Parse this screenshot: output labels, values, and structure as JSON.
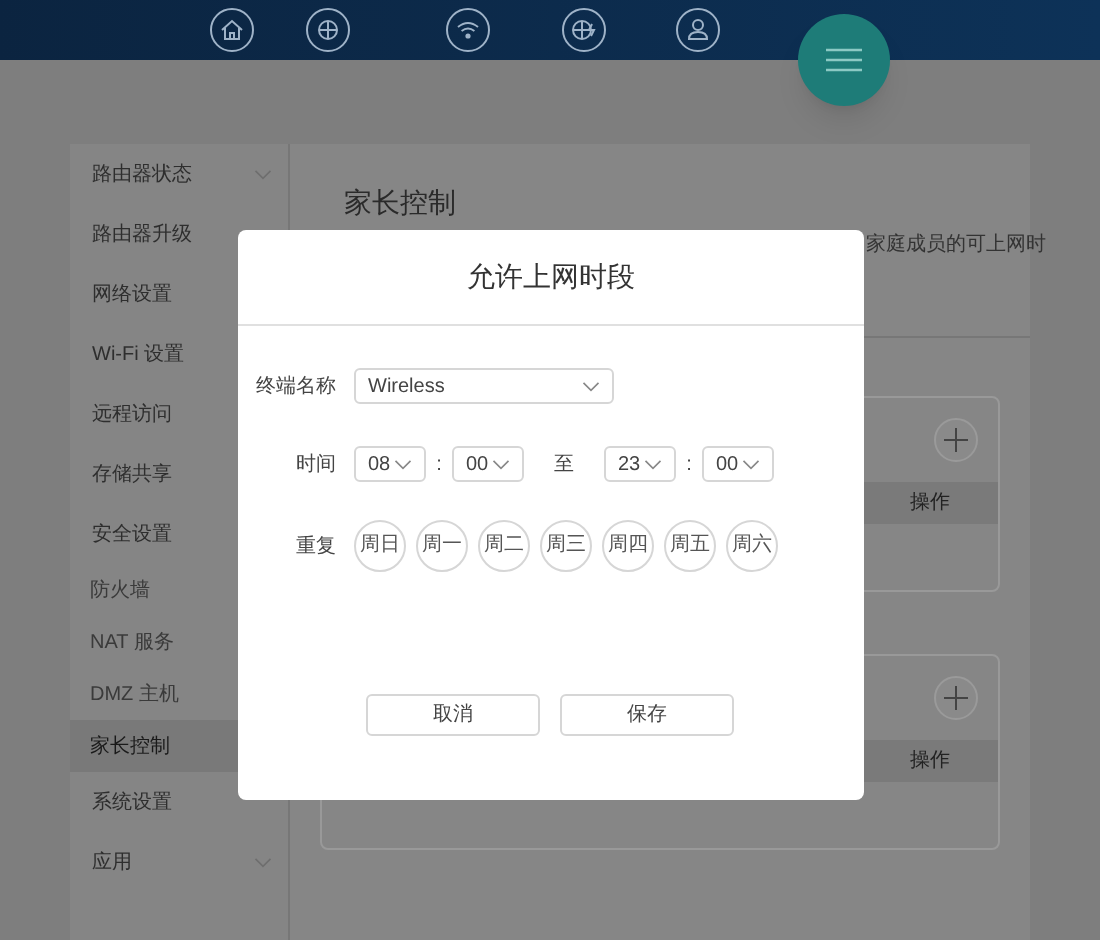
{
  "sidebar": {
    "items": [
      {
        "label": "路由器状态",
        "kind": "collapsible",
        "expanded": false
      },
      {
        "label": "路由器升级",
        "kind": "link"
      },
      {
        "label": "网络设置",
        "kind": "link"
      },
      {
        "label": "Wi-Fi 设置",
        "kind": "link"
      },
      {
        "label": "远程访问",
        "kind": "link"
      },
      {
        "label": "存储共享",
        "kind": "link"
      },
      {
        "label": "安全设置",
        "kind": "collapsible",
        "expanded": true,
        "children": [
          {
            "label": "防火墙",
            "selected": false
          },
          {
            "label": "NAT 服务",
            "selected": false
          },
          {
            "label": "DMZ 主机",
            "selected": false
          },
          {
            "label": "家长控制",
            "selected": true
          }
        ]
      },
      {
        "label": "系统设置",
        "kind": "link"
      },
      {
        "label": "应用",
        "kind": "collapsible",
        "expanded": false
      }
    ]
  },
  "page": {
    "title": "家长控制",
    "description": "家庭成员的可上网时",
    "cards": [
      {
        "columns": [
          "操作"
        ]
      },
      {
        "columns": [
          "操作"
        ]
      }
    ]
  },
  "dialog": {
    "title": "允许上网时段",
    "device": {
      "label": "终端名称",
      "value": "Wireless"
    },
    "time": {
      "label": "时间",
      "parts": [
        {
          "kind": "select",
          "value": "08"
        },
        {
          "kind": "text",
          "text": ":"
        },
        {
          "kind": "select",
          "value": "00"
        },
        {
          "kind": "range",
          "text": "至"
        },
        {
          "kind": "select",
          "value": "23"
        },
        {
          "kind": "text",
          "text": ":"
        },
        {
          "kind": "select",
          "value": "00"
        }
      ]
    },
    "repeat": {
      "label": "重复",
      "days": [
        {
          "label": "周日",
          "selected": false
        },
        {
          "label": "周一",
          "selected": false
        },
        {
          "label": "周二",
          "selected": false
        },
        {
          "label": "周三",
          "selected": false
        },
        {
          "label": "周四",
          "selected": false
        },
        {
          "label": "周五",
          "selected": false
        },
        {
          "label": "周六",
          "selected": false
        }
      ]
    },
    "buttons": [
      {
        "label": "取消"
      },
      {
        "label": "保存"
      }
    ]
  }
}
